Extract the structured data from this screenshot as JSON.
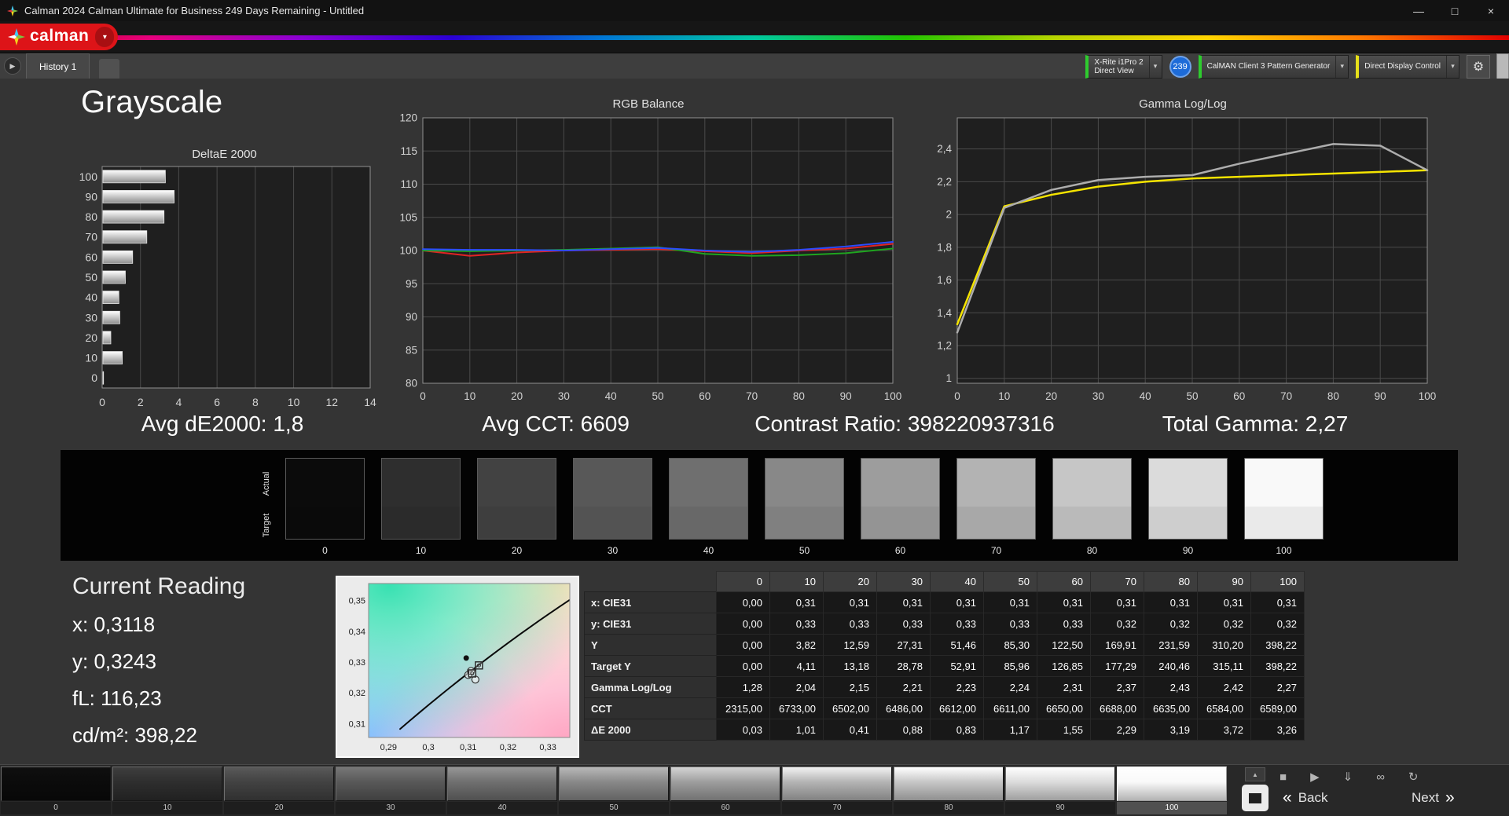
{
  "window": {
    "title": "Calman 2024 Calman Ultimate for Business 249 Days Remaining - Untitled",
    "logo_text": "calman",
    "controls": {
      "minimize": "—",
      "maximize": "□",
      "close": "×"
    }
  },
  "brand": {
    "logo_red": "#dd1418",
    "rainbow": [
      "#c40000",
      "#e6007e",
      "#8a00d4",
      "#2a00d4",
      "#0077d4",
      "#00c8a0",
      "#22c400",
      "#b7d400",
      "#ffd400",
      "#ff7a00",
      "#e00000"
    ]
  },
  "tabbar": {
    "history_arrow": "▶",
    "tab_label": "History 1",
    "meter_line1": "X-Rite i1Pro 2",
    "meter_line2": "Direct View",
    "meter_status_color": "#2ecc2e",
    "meter_badge": "239",
    "badge_color": "#1d6bd8",
    "pattern_label": "CalMAN Client 3 Pattern Generator",
    "pattern_status_color": "#2ecc2e",
    "display_label": "Direct Display Control",
    "display_status_color": "#e6df1a",
    "caret": "▾",
    "gear": "⚙"
  },
  "page": {
    "title": "Grayscale"
  },
  "stats": {
    "avg_de": "Avg dE2000: 1,8",
    "avg_cct": "Avg CCT: 6609",
    "contrast": "Contrast Ratio: 398220937316",
    "total_gamma": "Total Gamma: 2,27"
  },
  "grayscale": {
    "actual_label": "Actual",
    "target_label": "Target",
    "selected_level": "100",
    "levels": [
      {
        "label": "0",
        "color": "#0b0b0b"
      },
      {
        "label": "10",
        "color": "#2e2e2e"
      },
      {
        "label": "20",
        "color": "#424242"
      },
      {
        "label": "30",
        "color": "#585858"
      },
      {
        "label": "40",
        "color": "#6f6f6f"
      },
      {
        "label": "50",
        "color": "#888888"
      },
      {
        "label": "60",
        "color": "#9d9d9d"
      },
      {
        "label": "70",
        "color": "#b3b3b3"
      },
      {
        "label": "80",
        "color": "#c6c6c6"
      },
      {
        "label": "90",
        "color": "#dbdbdb"
      },
      {
        "label": "100",
        "color": "#f9f9f9"
      }
    ]
  },
  "current_reading": {
    "title": "Current Reading",
    "lines": [
      "x: 0,3118",
      "y: 0,3243",
      "fL: 116,23",
      "cd/m²: 398,22"
    ]
  },
  "table": {
    "columns": [
      "0",
      "10",
      "20",
      "30",
      "40",
      "50",
      "60",
      "70",
      "80",
      "90",
      "100"
    ],
    "rows": [
      {
        "label": "x: CIE31",
        "values": [
          "0,00",
          "0,31",
          "0,31",
          "0,31",
          "0,31",
          "0,31",
          "0,31",
          "0,31",
          "0,31",
          "0,31",
          "0,31"
        ]
      },
      {
        "label": "y: CIE31",
        "values": [
          "0,00",
          "0,33",
          "0,33",
          "0,33",
          "0,33",
          "0,33",
          "0,33",
          "0,32",
          "0,32",
          "0,32",
          "0,32"
        ]
      },
      {
        "label": "Y",
        "values": [
          "0,00",
          "3,82",
          "12,59",
          "27,31",
          "51,46",
          "85,30",
          "122,50",
          "169,91",
          "231,59",
          "310,20",
          "398,22"
        ]
      },
      {
        "label": "Target Y",
        "values": [
          "0,00",
          "4,11",
          "13,18",
          "28,78",
          "52,91",
          "85,96",
          "126,85",
          "177,29",
          "240,46",
          "315,11",
          "398,22"
        ]
      },
      {
        "label": "Gamma Log/Log",
        "values": [
          "1,28",
          "2,04",
          "2,15",
          "2,21",
          "2,23",
          "2,24",
          "2,31",
          "2,37",
          "2,43",
          "2,42",
          "2,27"
        ]
      },
      {
        "label": "CCT",
        "values": [
          "2315,00",
          "6733,00",
          "6502,00",
          "6486,00",
          "6612,00",
          "6611,00",
          "6650,00",
          "6688,00",
          "6635,00",
          "6584,00",
          "6589,00"
        ]
      },
      {
        "label": "ΔE 2000",
        "values": [
          "0,03",
          "1,01",
          "0,41",
          "0,88",
          "0,83",
          "1,17",
          "1,55",
          "2,29",
          "3,19",
          "3,72",
          "3,26"
        ]
      }
    ]
  },
  "chart_data": [
    {
      "id": "deltae",
      "type": "bar",
      "orientation": "horizontal",
      "title": "DeltaE 2000",
      "categories": [
        100,
        90,
        80,
        70,
        60,
        50,
        40,
        30,
        20,
        10,
        0
      ],
      "values": [
        3.26,
        3.72,
        3.19,
        2.29,
        1.55,
        1.17,
        0.83,
        0.88,
        0.41,
        1.01,
        0.03
      ],
      "xlim": [
        0,
        14
      ],
      "xticks": [
        0,
        2,
        4,
        6,
        8,
        10,
        12,
        14
      ],
      "grid": true
    },
    {
      "id": "rgb-balance",
      "type": "line",
      "title": "RGB Balance",
      "x": [
        0,
        10,
        20,
        30,
        40,
        50,
        60,
        70,
        80,
        90,
        100
      ],
      "xlim": [
        0,
        100
      ],
      "xticks": [
        0,
        10,
        20,
        30,
        40,
        50,
        60,
        70,
        80,
        90,
        100
      ],
      "ylim": [
        80,
        120
      ],
      "yticks": [
        120,
        115,
        110,
        105,
        100,
        95,
        90,
        85,
        80
      ],
      "grid": true,
      "series": [
        {
          "name": "Red",
          "color": "#e02424",
          "values": [
            100,
            99.2,
            99.7,
            100,
            100.1,
            100.2,
            99.9,
            99.6,
            100,
            100.3,
            101.0
          ]
        },
        {
          "name": "Green",
          "color": "#1fa51f",
          "values": [
            100,
            99.9,
            100,
            100.1,
            100.3,
            100.5,
            99.5,
            99.2,
            99.3,
            99.6,
            100.3
          ]
        },
        {
          "name": "Blue",
          "color": "#2b4bff",
          "values": [
            100.2,
            100.1,
            100.1,
            100,
            100.2,
            100.4,
            100,
            99.8,
            100.1,
            100.6,
            101.3
          ]
        }
      ]
    },
    {
      "id": "gamma-loglog",
      "type": "line",
      "title": "Gamma Log/Log",
      "x": [
        0,
        10,
        20,
        30,
        40,
        50,
        60,
        70,
        80,
        90,
        100
      ],
      "xlim": [
        0,
        100
      ],
      "xticks": [
        0,
        10,
        20,
        30,
        40,
        50,
        60,
        70,
        80,
        90,
        100
      ],
      "ylim": [
        0.97,
        2.59
      ],
      "yticks": [
        2.4,
        2.2,
        2,
        1.8,
        1.6,
        1.4,
        1.2,
        1
      ],
      "ytick_labels": [
        "2,4",
        "2,2",
        "2",
        "1,8",
        "1,6",
        "1,4",
        "1,2",
        "1"
      ],
      "grid": true,
      "series": [
        {
          "name": "Target Gamma",
          "color": "#f5e400",
          "width": 2.5,
          "values": [
            1.33,
            2.05,
            2.12,
            2.17,
            2.2,
            2.22,
            2.23,
            2.24,
            2.25,
            2.26,
            2.27
          ]
        },
        {
          "name": "Measured Gamma",
          "color": "#adadad",
          "width": 2.5,
          "values": [
            1.28,
            2.04,
            2.15,
            2.21,
            2.23,
            2.24,
            2.31,
            2.37,
            2.43,
            2.42,
            2.27
          ]
        }
      ]
    },
    {
      "id": "cie-xy",
      "type": "scatter",
      "title": "CIE xy Chromaticity",
      "xlim": [
        0.285,
        0.3355
      ],
      "ylim": [
        0.3055,
        0.3555
      ],
      "xticks": [
        0.29,
        0.3,
        0.31,
        0.32,
        0.33
      ],
      "xtick_labels": [
        "0,29",
        "0,3",
        "0,31",
        "0,32",
        "0,33"
      ],
      "yticks": [
        0.31,
        0.32,
        0.33,
        0.34,
        0.35
      ],
      "ytick_labels": [
        "0,31",
        "0,32",
        "0,33",
        "0,34",
        "0,35"
      ],
      "points": [
        {
          "x": 0.3095,
          "y": 0.3313
        }
      ],
      "target_markers": [
        {
          "x": 0.3127,
          "y": 0.3289
        },
        {
          "x": 0.311,
          "y": 0.3263
        }
      ],
      "measured_markers": [
        {
          "x": 0.3118,
          "y": 0.3243
        },
        {
          "x": 0.31,
          "y": 0.3258
        },
        {
          "x": 0.3107,
          "y": 0.3271
        }
      ]
    }
  ],
  "bottombar": {
    "collapse_icon": "▲",
    "transport": [
      {
        "name": "stop-icon",
        "glyph": "■"
      },
      {
        "name": "play-icon",
        "glyph": "▶"
      },
      {
        "name": "save-icon",
        "glyph": "⇓"
      },
      {
        "name": "link-icon",
        "glyph": "∞"
      },
      {
        "name": "refresh-icon",
        "glyph": "↻"
      }
    ],
    "back_chevron": "«",
    "back_label": "Back",
    "next_label": "Next",
    "next_chevron": "»"
  }
}
